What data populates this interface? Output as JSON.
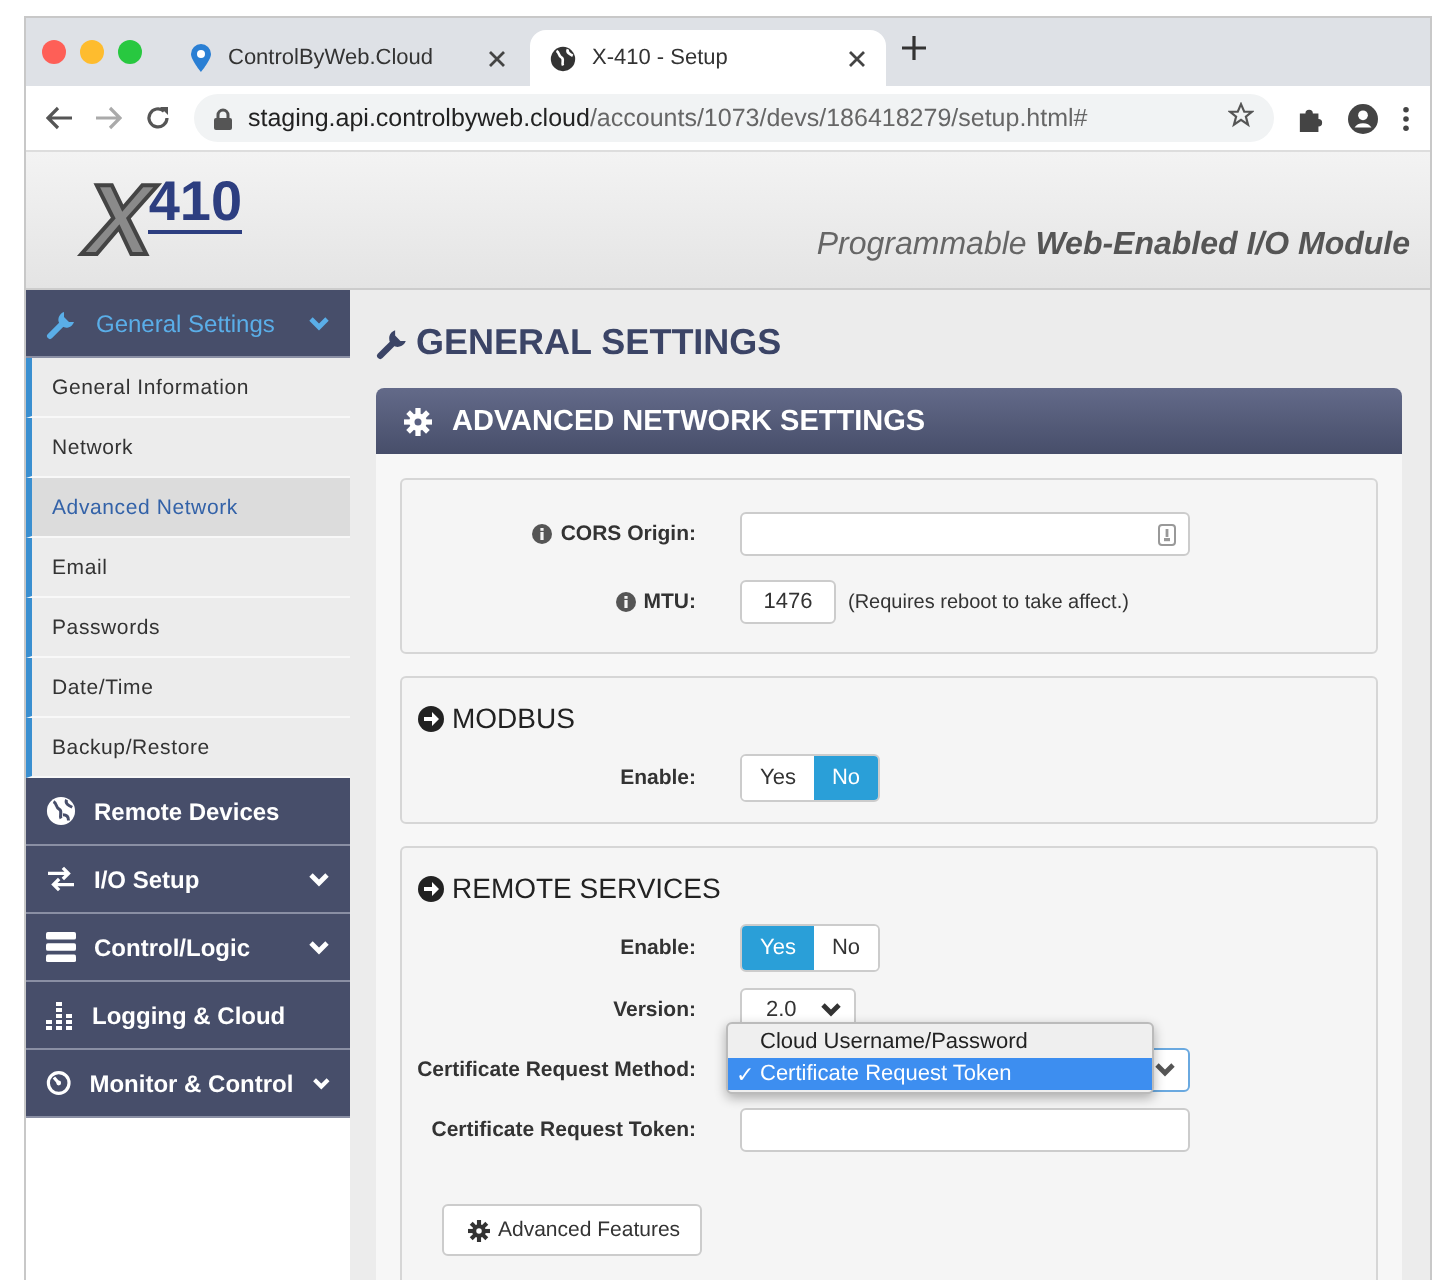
{
  "browser": {
    "tabs": [
      {
        "title": "ControlByWeb.Cloud",
        "selected": false
      },
      {
        "title": "X-410 - Setup",
        "selected": true
      }
    ],
    "url_host": "staging.api.controlbyweb.cloud",
    "url_path": "/accounts/1073/devs/186418279/setup.html#"
  },
  "header": {
    "logo_letter": "X",
    "logo_number": "410",
    "tagline": "Programmable **Web-Enabled I/O Module**"
  },
  "sidebar": {
    "items": [
      {
        "label": "General Settings",
        "expandable": true,
        "expanded": true,
        "children": [
          {
            "label": "General Information",
            "selected": false
          },
          {
            "label": "Network",
            "selected": false
          },
          {
            "label": "Advanced Network",
            "selected": true
          },
          {
            "label": "Email",
            "selected": false
          },
          {
            "label": "Passwords",
            "selected": false
          },
          {
            "label": "Date/Time",
            "selected": false
          },
          {
            "label": "Backup/Restore",
            "selected": false
          }
        ]
      },
      {
        "label": "Remote Devices",
        "expandable": false,
        "expanded": false
      },
      {
        "label": "I/O Setup",
        "expandable": true,
        "expanded": false
      },
      {
        "label": "Control/Logic",
        "expandable": true,
        "expanded": false
      },
      {
        "label": "Logging & Cloud",
        "expandable": false,
        "expanded": false
      },
      {
        "label": "Monitor & Control",
        "expandable": true,
        "expanded": false
      }
    ]
  },
  "content": {
    "title": "GENERAL SETTINGS",
    "panel_title": "ADVANCED NETWORK SETTINGS",
    "sections": [
      {
        "fields": [
          {
            "kind": "text",
            "label": "CORS Origin:",
            "info": true
          },
          {
            "kind": "short_text",
            "label": "MTU:",
            "info": true,
            "value": "1476",
            "note": "(Requires reboot to take affect.)"
          }
        ]
      },
      {
        "title": "MODBUS",
        "fields": [
          {
            "kind": "toggle",
            "label": "Enable:",
            "info": false,
            "options": [
              {
                "label": "Yes",
                "selected": false
              },
              {
                "label": "No",
                "selected": true
              }
            ]
          }
        ]
      },
      {
        "title": "REMOTE SERVICES",
        "fields": [
          {
            "kind": "toggle",
            "label": "Enable:",
            "info": false,
            "options": [
              {
                "label": "Yes",
                "selected": true
              },
              {
                "label": "No",
                "selected": false
              }
            ]
          },
          {
            "kind": "select",
            "label": "Version:",
            "info": false,
            "value": "2.0"
          },
          {
            "kind": "dropdown",
            "label": "Certificate Request Method:",
            "info": false,
            "mark": "✓",
            "options": [
              {
                "label": "Cloud Username/Password",
                "selected": false
              },
              {
                "label": "Certificate Request Token",
                "selected": true
              }
            ]
          },
          {
            "kind": "text",
            "label": "Certificate Request Token:",
            "info": false
          },
          {
            "kind": "button",
            "label": "Advanced Features"
          }
        ]
      }
    ]
  }
}
